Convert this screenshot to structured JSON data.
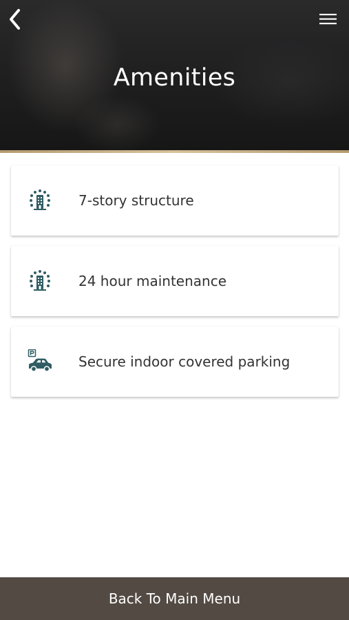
{
  "header": {
    "title": "Amenities",
    "back_icon": "chevron-left-icon",
    "menu_icon": "hamburger-menu-icon"
  },
  "amenities": [
    {
      "label": "7-story structure",
      "icon": "building-icon"
    },
    {
      "label": "24 hour maintenance",
      "icon": "building-icon"
    },
    {
      "label": "Secure indoor covered parking",
      "icon": "parking-car-icon"
    }
  ],
  "footer": {
    "label": "Back To Main Menu"
  },
  "colors": {
    "accent_icon": "#2f5d63",
    "footer_bg": "#524a43",
    "gold_line": "#c9b08a"
  }
}
